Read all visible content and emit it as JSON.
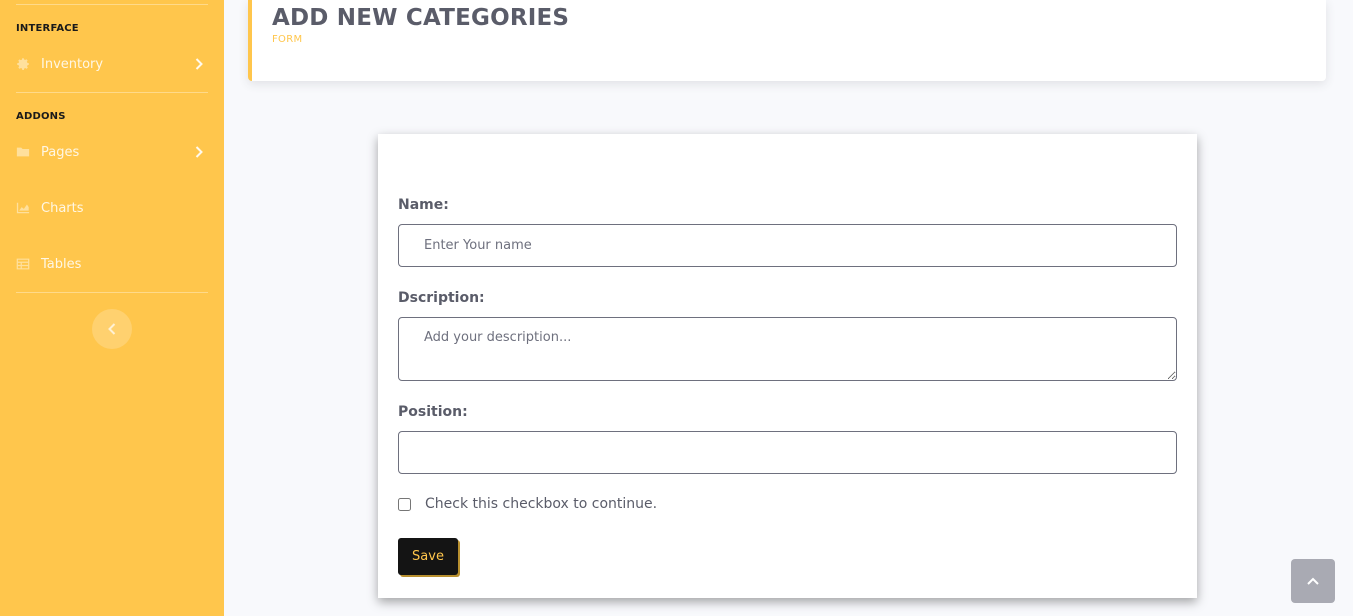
{
  "sidebar": {
    "sections": [
      {
        "heading": "INTERFACE",
        "items": [
          {
            "label": "Inventory",
            "icon": "gear-icon",
            "has_submenu": true
          }
        ]
      },
      {
        "heading": "ADDONS",
        "items": [
          {
            "label": "Pages",
            "icon": "folder-icon",
            "has_submenu": true
          },
          {
            "label": "Charts",
            "icon": "chart-area-icon",
            "has_submenu": false
          },
          {
            "label": "Tables",
            "icon": "table-icon",
            "has_submenu": false
          }
        ]
      }
    ],
    "toggle_icon": "chevron-left-icon"
  },
  "header": {
    "title": "ADD NEW CATEGORIES",
    "subtitle": "FORM"
  },
  "form": {
    "name_label": "Name:",
    "name_placeholder": "Enter Your name",
    "name_value": "",
    "description_label": "Dscription:",
    "description_placeholder": "Add your description...",
    "description_value": "",
    "position_label": "Position:",
    "position_value": "",
    "checkbox_label": "Check this checkbox to continue.",
    "checkbox_checked": false,
    "save_label": "Save"
  },
  "scroll_to_top_icon": "chevron-up-icon",
  "colors": {
    "accent": "#ffc64c",
    "text": "#5a5c69",
    "button_bg": "#141414",
    "page_bg": "#f8f9fc"
  }
}
